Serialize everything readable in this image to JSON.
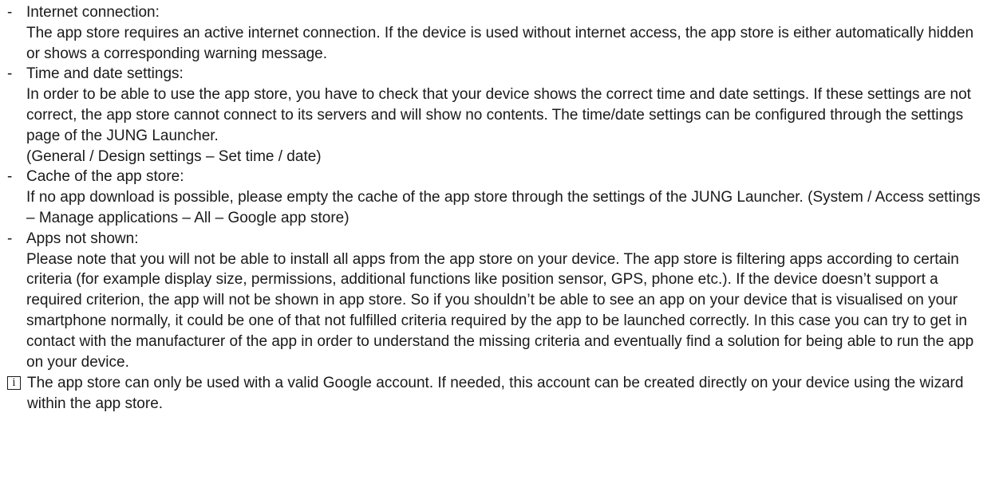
{
  "bullet_char": "-",
  "items": [
    {
      "heading": "Internet connection:",
      "paragraphs": [
        "The app store requires an active internet connection. If the device is used without internet access, the app store is either automatically hidden or shows a corresponding warning message."
      ]
    },
    {
      "heading": "Time and date settings:",
      "paragraphs": [
        "In order to be able to use the app store, you have to check that your device shows the correct time and date set­tings. If these settings are not correct, the app store cannot connect to its servers and will show no contents. The time/date settings can be configured through the settings page of the JUNG Launcher.",
        "(General / Design settings – Set time / date)"
      ]
    },
    {
      "heading": "Cache of the app store:",
      "paragraphs": [
        "If no app download is possible, please empty the cache of the app store through the settings of the JUNG Launch­er. (System / Access settings – Manage applications – All – Google app store)"
      ]
    },
    {
      "heading": "Apps not shown:",
      "paragraphs": [
        "Please note that you will not be able to install all apps from the app store on your device. The app store is filtering apps according to certain criteria (for example display size, permissions, additional functions like position sensor, GPS, phone etc.). If the device doesn’t support a required criterion, the app will not be shown in app store. So if you shouldn’t be able to see an app on your device that is visualised on your smartphone normally, it could be one of that not fulfilled criteria required by the app to be launched correctly. In this case you can try to get in contact with the manufacturer of the app in order to understand the missing criteria and eventually find a solution for being able to run the app on your device."
      ]
    }
  ],
  "info": {
    "icon_glyph": "i",
    "icon_name": "info-icon",
    "text": "The app store can only be used with a valid Google account. If needed, this account can be created directly on your device using the wizard within the app store."
  }
}
